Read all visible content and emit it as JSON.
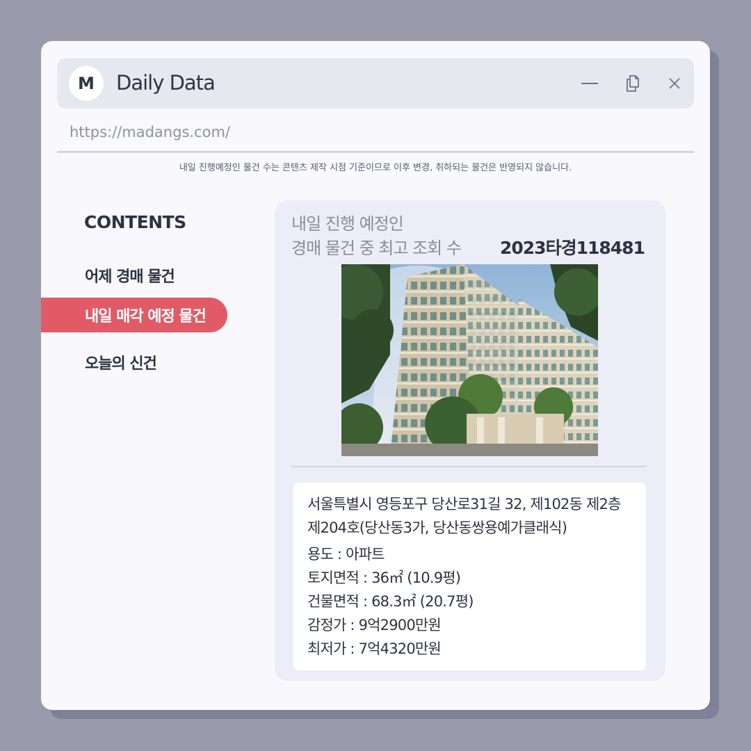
{
  "window": {
    "logo_letter": "M",
    "title": "Daily Data",
    "url": "https://madangs.com/"
  },
  "notice": "내일 진행예정인 물건 수는 콘텐츠 제작 시점 기준이므로 이후 변경, 취하되는 물건은 반영되지 않습니다.",
  "sidebar": {
    "heading": "CONTENTS",
    "items": [
      {
        "label": "어제 경매 물건",
        "active": false
      },
      {
        "label": "내일 매각 예정 물건",
        "active": true
      },
      {
        "label": "오늘의 신건",
        "active": false
      }
    ]
  },
  "card": {
    "title_line1": "내일 진행 예정인",
    "title_line2": "경매 물건 중 최고 조회 수",
    "case_number": "2023타경118481",
    "address_line1": "서울특별시 영등포구 당산로31길 32, 제102동 제2층",
    "address_line2": "제204호(당산동3가, 당산동쌍용예가클래식)",
    "usage": "용도 : 아파트",
    "land_area": "토지면적 : 36㎡ (10.9평)",
    "building_area": "건물면적 : 68.3㎡ (20.7평)",
    "appraisal": "감정가 : 9억2900만원",
    "min_price": "최저가 : 7억4320만원"
  },
  "colors": {
    "accent": "#e15b66",
    "background": "#9a9aad",
    "card": "#ededf8",
    "text": "#2c3340"
  }
}
